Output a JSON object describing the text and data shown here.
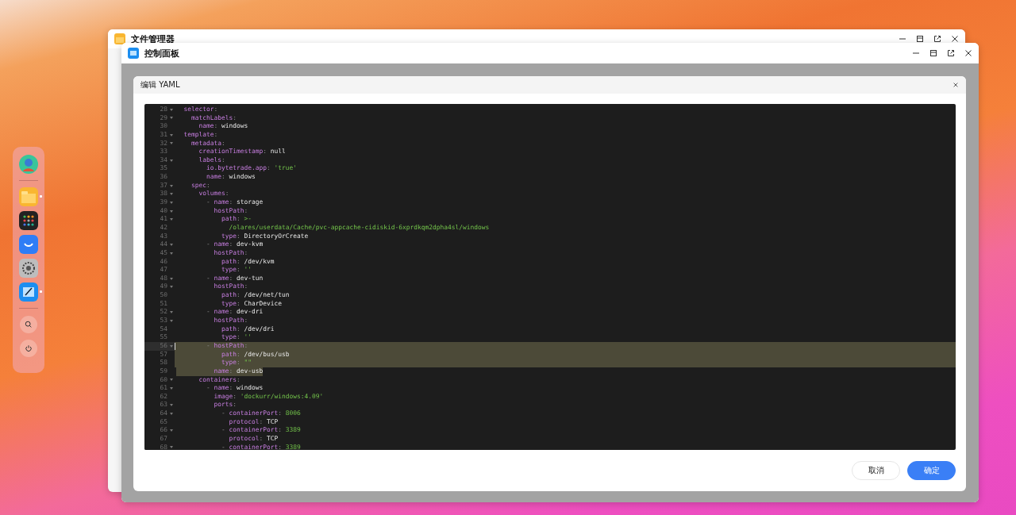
{
  "dock": {
    "items": [
      {
        "kind": "avatar",
        "running": false
      },
      {
        "kind": "files",
        "running": true
      },
      {
        "kind": "apps",
        "running": false
      },
      {
        "kind": "market",
        "running": false
      },
      {
        "kind": "settings",
        "running": false
      },
      {
        "kind": "control",
        "running": true
      },
      {
        "kind": "search",
        "running": false
      },
      {
        "kind": "power",
        "running": false
      }
    ]
  },
  "back_window": {
    "title": "文件管理器"
  },
  "front_window": {
    "title": "控制面板"
  },
  "dialog": {
    "title": "编辑 YAML",
    "editor": {
      "lines": [
        {
          "num": "28",
          "fold": true,
          "selected": false,
          "tokens": [
            {
              "text": "  selector",
              "kind": "key"
            },
            {
              "text": ":",
              "kind": "punct"
            }
          ]
        },
        {
          "num": "29",
          "fold": true,
          "selected": false,
          "tokens": [
            {
              "text": "    matchLabels",
              "kind": "key"
            },
            {
              "text": ":",
              "kind": "punct"
            }
          ]
        },
        {
          "num": "30",
          "fold": false,
          "selected": false,
          "tokens": [
            {
              "text": "      name",
              "kind": "key"
            },
            {
              "text": ": ",
              "kind": "punct"
            },
            {
              "text": "windows",
              "kind": "plain"
            }
          ]
        },
        {
          "num": "31",
          "fold": true,
          "selected": false,
          "tokens": [
            {
              "text": "  template",
              "kind": "key"
            },
            {
              "text": ":",
              "kind": "punct"
            }
          ]
        },
        {
          "num": "32",
          "fold": true,
          "selected": false,
          "tokens": [
            {
              "text": "    metadata",
              "kind": "key"
            },
            {
              "text": ":",
              "kind": "punct"
            }
          ]
        },
        {
          "num": "33",
          "fold": false,
          "selected": false,
          "tokens": [
            {
              "text": "      creationTimestamp",
              "kind": "key"
            },
            {
              "text": ": ",
              "kind": "punct"
            },
            {
              "text": "null",
              "kind": "plain"
            }
          ]
        },
        {
          "num": "34",
          "fold": true,
          "selected": false,
          "tokens": [
            {
              "text": "      labels",
              "kind": "key"
            },
            {
              "text": ":",
              "kind": "punct"
            }
          ]
        },
        {
          "num": "35",
          "fold": false,
          "selected": false,
          "tokens": [
            {
              "text": "        io.bytetrade.app",
              "kind": "key"
            },
            {
              "text": ": ",
              "kind": "punct"
            },
            {
              "text": "'true'",
              "kind": "string"
            }
          ]
        },
        {
          "num": "36",
          "fold": false,
          "selected": false,
          "tokens": [
            {
              "text": "        name",
              "kind": "key"
            },
            {
              "text": ": ",
              "kind": "punct"
            },
            {
              "text": "windows",
              "kind": "plain"
            }
          ]
        },
        {
          "num": "37",
          "fold": true,
          "selected": false,
          "tokens": [
            {
              "text": "    spec",
              "kind": "key"
            },
            {
              "text": ":",
              "kind": "punct"
            }
          ]
        },
        {
          "num": "38",
          "fold": true,
          "selected": false,
          "tokens": [
            {
              "text": "      volumes",
              "kind": "key"
            },
            {
              "text": ":",
              "kind": "punct"
            }
          ]
        },
        {
          "num": "39",
          "fold": true,
          "selected": false,
          "tokens": [
            {
              "text": "        - ",
              "kind": "punct"
            },
            {
              "text": "name",
              "kind": "key"
            },
            {
              "text": ": ",
              "kind": "punct"
            },
            {
              "text": "storage",
              "kind": "plain"
            }
          ]
        },
        {
          "num": "40",
          "fold": true,
          "selected": false,
          "tokens": [
            {
              "text": "          hostPath",
              "kind": "key"
            },
            {
              "text": ":",
              "kind": "punct"
            }
          ]
        },
        {
          "num": "41",
          "fold": true,
          "selected": false,
          "tokens": [
            {
              "text": "            path",
              "kind": "key"
            },
            {
              "text": ": ",
              "kind": "punct"
            },
            {
              "text": ">-",
              "kind": "string"
            }
          ]
        },
        {
          "num": "42",
          "fold": false,
          "selected": false,
          "tokens": [
            {
              "text": "              /olares/userdata/Cache/pvc-appcache-cidiskid-6xprdkqm2dpha4sl/windows",
              "kind": "string"
            }
          ]
        },
        {
          "num": "43",
          "fold": false,
          "selected": false,
          "tokens": [
            {
              "text": "            type",
              "kind": "key"
            },
            {
              "text": ": ",
              "kind": "punct"
            },
            {
              "text": "DirectoryOrCreate",
              "kind": "plain"
            }
          ]
        },
        {
          "num": "44",
          "fold": true,
          "selected": false,
          "tokens": [
            {
              "text": "        - ",
              "kind": "punct"
            },
            {
              "text": "name",
              "kind": "key"
            },
            {
              "text": ": ",
              "kind": "punct"
            },
            {
              "text": "dev-kvm",
              "kind": "plain"
            }
          ]
        },
        {
          "num": "45",
          "fold": true,
          "selected": false,
          "tokens": [
            {
              "text": "          hostPath",
              "kind": "key"
            },
            {
              "text": ":",
              "kind": "punct"
            }
          ]
        },
        {
          "num": "46",
          "fold": false,
          "selected": false,
          "tokens": [
            {
              "text": "            path",
              "kind": "key"
            },
            {
              "text": ": ",
              "kind": "punct"
            },
            {
              "text": "/dev/kvm",
              "kind": "plain"
            }
          ]
        },
        {
          "num": "47",
          "fold": false,
          "selected": false,
          "tokens": [
            {
              "text": "            type",
              "kind": "key"
            },
            {
              "text": ": ",
              "kind": "punct"
            },
            {
              "text": "''",
              "kind": "string"
            }
          ]
        },
        {
          "num": "48",
          "fold": true,
          "selected": false,
          "tokens": [
            {
              "text": "        - ",
              "kind": "punct"
            },
            {
              "text": "name",
              "kind": "key"
            },
            {
              "text": ": ",
              "kind": "punct"
            },
            {
              "text": "dev-tun",
              "kind": "plain"
            }
          ]
        },
        {
          "num": "49",
          "fold": true,
          "selected": false,
          "tokens": [
            {
              "text": "          hostPath",
              "kind": "key"
            },
            {
              "text": ":",
              "kind": "punct"
            }
          ]
        },
        {
          "num": "50",
          "fold": false,
          "selected": false,
          "tokens": [
            {
              "text": "            path",
              "kind": "key"
            },
            {
              "text": ": ",
              "kind": "punct"
            },
            {
              "text": "/dev/net/tun",
              "kind": "plain"
            }
          ]
        },
        {
          "num": "51",
          "fold": false,
          "selected": false,
          "tokens": [
            {
              "text": "            type",
              "kind": "key"
            },
            {
              "text": ": ",
              "kind": "punct"
            },
            {
              "text": "CharDevice",
              "kind": "plain"
            }
          ]
        },
        {
          "num": "52",
          "fold": true,
          "selected": false,
          "tokens": [
            {
              "text": "        - ",
              "kind": "punct"
            },
            {
              "text": "name",
              "kind": "key"
            },
            {
              "text": ": ",
              "kind": "punct"
            },
            {
              "text": "dev-dri",
              "kind": "plain"
            }
          ]
        },
        {
          "num": "53",
          "fold": true,
          "selected": false,
          "tokens": [
            {
              "text": "          hostPath",
              "kind": "key"
            },
            {
              "text": ":",
              "kind": "punct"
            }
          ]
        },
        {
          "num": "54",
          "fold": false,
          "selected": false,
          "tokens": [
            {
              "text": "            path",
              "kind": "key"
            },
            {
              "text": ": ",
              "kind": "punct"
            },
            {
              "text": "/dev/dri",
              "kind": "plain"
            }
          ]
        },
        {
          "num": "55",
          "fold": false,
          "selected": false,
          "tokens": [
            {
              "text": "            type",
              "kind": "key"
            },
            {
              "text": ": ",
              "kind": "punct"
            },
            {
              "text": "''",
              "kind": "string"
            }
          ]
        },
        {
          "num": "56",
          "fold": true,
          "selected": true,
          "cursor": true,
          "tokens": [
            {
              "text": "        - ",
              "kind": "punct"
            },
            {
              "text": "hostPath",
              "kind": "key"
            },
            {
              "text": ":",
              "kind": "punct"
            }
          ]
        },
        {
          "num": "57",
          "fold": false,
          "selected": true,
          "tokens": [
            {
              "text": "            path",
              "kind": "key"
            },
            {
              "text": ": ",
              "kind": "punct"
            },
            {
              "text": "/dev/bus/usb",
              "kind": "plain"
            }
          ]
        },
        {
          "num": "58",
          "fold": false,
          "selected": true,
          "tokens": [
            {
              "text": "            type",
              "kind": "key"
            },
            {
              "text": ": ",
              "kind": "punct"
            },
            {
              "text": "\"\"",
              "kind": "string"
            }
          ]
        },
        {
          "num": "59",
          "fold": false,
          "selected": true,
          "partial": true,
          "tokens": [
            {
              "text": "          name",
              "kind": "key"
            },
            {
              "text": ": ",
              "kind": "punct"
            },
            {
              "text": "dev-usb",
              "kind": "plain"
            }
          ]
        },
        {
          "num": "60",
          "fold": true,
          "selected": false,
          "tokens": [
            {
              "text": "      containers",
              "kind": "key"
            },
            {
              "text": ":",
              "kind": "punct"
            }
          ]
        },
        {
          "num": "61",
          "fold": true,
          "selected": false,
          "tokens": [
            {
              "text": "        - ",
              "kind": "punct"
            },
            {
              "text": "name",
              "kind": "key"
            },
            {
              "text": ": ",
              "kind": "punct"
            },
            {
              "text": "windows",
              "kind": "plain"
            }
          ]
        },
        {
          "num": "62",
          "fold": false,
          "selected": false,
          "tokens": [
            {
              "text": "          image",
              "kind": "key"
            },
            {
              "text": ": ",
              "kind": "punct"
            },
            {
              "text": "'dockurr/windows:4.09'",
              "kind": "string"
            }
          ]
        },
        {
          "num": "63",
          "fold": true,
          "selected": false,
          "tokens": [
            {
              "text": "          ports",
              "kind": "key"
            },
            {
              "text": ":",
              "kind": "punct"
            }
          ]
        },
        {
          "num": "64",
          "fold": true,
          "selected": false,
          "tokens": [
            {
              "text": "            - ",
              "kind": "punct"
            },
            {
              "text": "containerPort",
              "kind": "key"
            },
            {
              "text": ": ",
              "kind": "punct"
            },
            {
              "text": "8006",
              "kind": "string"
            }
          ]
        },
        {
          "num": "65",
          "fold": false,
          "selected": false,
          "tokens": [
            {
              "text": "              protocol",
              "kind": "key"
            },
            {
              "text": ": ",
              "kind": "punct"
            },
            {
              "text": "TCP",
              "kind": "plain"
            }
          ]
        },
        {
          "num": "66",
          "fold": true,
          "selected": false,
          "tokens": [
            {
              "text": "            - ",
              "kind": "punct"
            },
            {
              "text": "containerPort",
              "kind": "key"
            },
            {
              "text": ": ",
              "kind": "punct"
            },
            {
              "text": "3389",
              "kind": "string"
            }
          ]
        },
        {
          "num": "67",
          "fold": false,
          "selected": false,
          "tokens": [
            {
              "text": "              protocol",
              "kind": "key"
            },
            {
              "text": ": ",
              "kind": "punct"
            },
            {
              "text": "TCP",
              "kind": "plain"
            }
          ]
        },
        {
          "num": "68",
          "fold": true,
          "selected": false,
          "tokens": [
            {
              "text": "            - ",
              "kind": "punct"
            },
            {
              "text": "containerPort",
              "kind": "key"
            },
            {
              "text": ": ",
              "kind": "punct"
            },
            {
              "text": "3389",
              "kind": "string"
            }
          ]
        }
      ]
    },
    "buttons": [
      {
        "label": "取消",
        "kind": "secondary"
      },
      {
        "label": "确定",
        "kind": "primary"
      }
    ]
  }
}
